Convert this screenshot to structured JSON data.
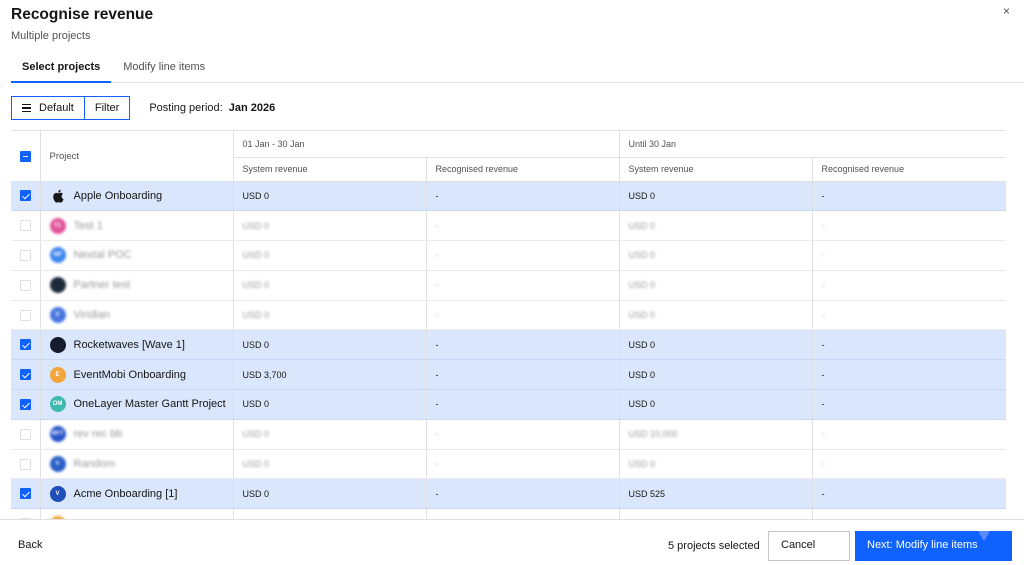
{
  "dialog": {
    "title": "Recognise revenue",
    "subtitle": "Multiple projects",
    "close_icon": "×"
  },
  "tabs": [
    {
      "label": "Select projects",
      "active": true
    },
    {
      "label": "Modify line items",
      "active": false
    }
  ],
  "toolbar": {
    "default_label": "Default",
    "filter_label": "Filter",
    "posting_label": "Posting period:",
    "posting_value": "Jan 2026"
  },
  "table": {
    "project_header": "Project",
    "group1_header": "01 Jan - 30 Jan",
    "group2_header": "Until 30 Jan",
    "system_revenue_header": "System revenue",
    "recognised_revenue_header": "Recognised revenue",
    "rows": [
      {
        "name": "Apple Onboarding",
        "selected": true,
        "icon": "apple-icon",
        "icon_color": "#ffffff",
        "p1_sys": "USD 0",
        "p1_rec": "-",
        "p2_sys": "USD 0",
        "p2_rec": "-"
      },
      {
        "name": "Test 1",
        "selected": false,
        "icon": "T1",
        "icon_color": "#e0559a",
        "p1_sys": "USD 0",
        "p1_rec": "-",
        "p2_sys": "USD 0",
        "p2_rec": "-"
      },
      {
        "name": "Nextal POC",
        "selected": false,
        "icon": "NP",
        "icon_color": "#3d86f0",
        "p1_sys": "USD 0",
        "p1_rec": "-",
        "p2_sys": "USD 0",
        "p2_rec": "-"
      },
      {
        "name": "Partner test",
        "selected": false,
        "icon": "",
        "icon_color": "#1c2a3a",
        "p1_sys": "USD 0",
        "p1_rec": "-",
        "p2_sys": "USD 0",
        "p2_rec": "-"
      },
      {
        "name": "Viridian",
        "selected": false,
        "icon": "V",
        "icon_color": "#4a78e0",
        "p1_sys": "USD 0",
        "p1_rec": "-",
        "p2_sys": "USD 0",
        "p2_rec": "-"
      },
      {
        "name": "Rocketwaves [Wave 1]",
        "selected": true,
        "icon": "",
        "icon_color": "#161b2e",
        "p1_sys": "USD 0",
        "p1_rec": "-",
        "p2_sys": "USD 0",
        "p2_rec": "-"
      },
      {
        "name": "EventMobi Onboarding",
        "selected": true,
        "icon": "E",
        "icon_color": "#f1a53a",
        "p1_sys": "USD 3,700",
        "p1_rec": "-",
        "p2_sys": "USD 0",
        "p2_rec": "-"
      },
      {
        "name": "OneLayer Master Gantt Project",
        "selected": true,
        "icon": "OM",
        "icon_color": "#3fb8b0",
        "p1_sys": "USD 0",
        "p1_rec": "-",
        "p2_sys": "USD 0",
        "p2_rec": "-"
      },
      {
        "name": "rev rec bb",
        "selected": false,
        "icon": "RFT",
        "icon_color": "#2a55c8",
        "p1_sys": "USD 0",
        "p1_rec": "-",
        "p2_sys": "USD 10,000",
        "p2_rec": "-"
      },
      {
        "name": "Random",
        "selected": false,
        "icon": "V",
        "icon_color": "#2a60c8",
        "p1_sys": "USD 0",
        "p1_rec": "-",
        "p2_sys": "USD 0",
        "p2_rec": "-"
      },
      {
        "name": "Acme Onboarding [1]",
        "selected": true,
        "icon": "V",
        "icon_color": "#1f4fb8",
        "p1_sys": "USD 0",
        "p1_rec": "-",
        "p2_sys": "USD 525",
        "p2_rec": "-"
      },
      {
        "name": "",
        "selected": false,
        "icon": "",
        "icon_color": "#f1a53a",
        "p1_sys": "",
        "p1_rec": "",
        "p2_sys": "",
        "p2_rec": ""
      }
    ]
  },
  "footer": {
    "back_label": "Back",
    "selected_count": "5 projects selected",
    "cancel_label": "Cancel",
    "next_label": "Next: Modify line items"
  },
  "colors": {
    "accent": "#0f62fe",
    "selected_row": "#d9e6fb"
  }
}
